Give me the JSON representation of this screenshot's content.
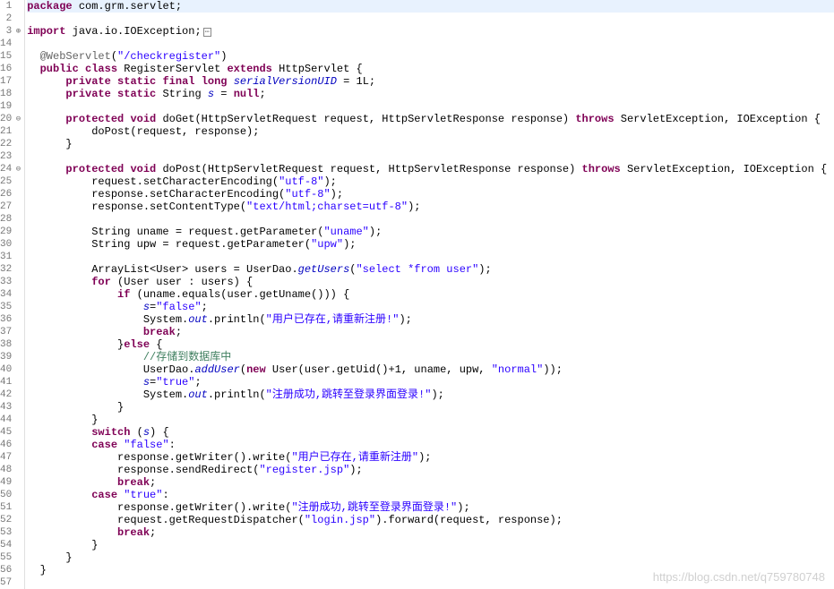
{
  "watermark": "https://blog.csdn.net/q759780748",
  "lines": [
    {
      "num": "1",
      "fold": "",
      "hl": true,
      "segs": [
        {
          "c": "kw",
          "t": "package"
        },
        {
          "t": " com.grm.servlet;"
        }
      ]
    },
    {
      "num": "2",
      "fold": "",
      "segs": []
    },
    {
      "num": "3",
      "fold": "⊕",
      "segs": [
        {
          "c": "kw",
          "t": "import"
        },
        {
          "t": " java.io.IOException;"
        },
        {
          "c": "expand",
          "t": " "
        }
      ]
    },
    {
      "num": "14",
      "fold": "",
      "segs": []
    },
    {
      "num": "15",
      "fold": "",
      "segs": [
        {
          "t": "  "
        },
        {
          "c": "ann",
          "t": "@WebServlet"
        },
        {
          "t": "("
        },
        {
          "c": "str",
          "t": "\"/checkregister\""
        },
        {
          "t": ")"
        }
      ]
    },
    {
      "num": "16",
      "fold": "",
      "segs": [
        {
          "t": "  "
        },
        {
          "c": "kw",
          "t": "public"
        },
        {
          "t": " "
        },
        {
          "c": "kw",
          "t": "class"
        },
        {
          "t": " RegisterServlet "
        },
        {
          "c": "kw",
          "t": "extends"
        },
        {
          "t": " HttpServlet {"
        }
      ]
    },
    {
      "num": "17",
      "fold": "",
      "segs": [
        {
          "t": "      "
        },
        {
          "c": "kw",
          "t": "private"
        },
        {
          "t": " "
        },
        {
          "c": "kw",
          "t": "static"
        },
        {
          "t": " "
        },
        {
          "c": "kw",
          "t": "final"
        },
        {
          "t": " "
        },
        {
          "c": "kw",
          "t": "long"
        },
        {
          "t": " "
        },
        {
          "c": "static-field",
          "t": "serialVersionUID"
        },
        {
          "t": " = 1L;"
        }
      ]
    },
    {
      "num": "18",
      "fold": "",
      "segs": [
        {
          "t": "      "
        },
        {
          "c": "kw",
          "t": "private"
        },
        {
          "t": " "
        },
        {
          "c": "kw",
          "t": "static"
        },
        {
          "t": " String "
        },
        {
          "c": "static-field",
          "t": "s"
        },
        {
          "t": " = "
        },
        {
          "c": "kw",
          "t": "null"
        },
        {
          "t": ";"
        }
      ]
    },
    {
      "num": "19",
      "fold": "",
      "segs": []
    },
    {
      "num": "20",
      "fold": "⊖",
      "segs": [
        {
          "t": "      "
        },
        {
          "c": "kw",
          "t": "protected"
        },
        {
          "t": " "
        },
        {
          "c": "kw",
          "t": "void"
        },
        {
          "t": " doGet(HttpServletRequest request, HttpServletResponse response) "
        },
        {
          "c": "kw",
          "t": "throws"
        },
        {
          "t": " ServletException, IOException {"
        }
      ]
    },
    {
      "num": "21",
      "fold": "",
      "segs": [
        {
          "t": "          doPost(request, response);"
        }
      ]
    },
    {
      "num": "22",
      "fold": "",
      "segs": [
        {
          "t": "      }"
        }
      ]
    },
    {
      "num": "23",
      "fold": "",
      "segs": []
    },
    {
      "num": "24",
      "fold": "⊖",
      "segs": [
        {
          "t": "      "
        },
        {
          "c": "kw",
          "t": "protected"
        },
        {
          "t": " "
        },
        {
          "c": "kw",
          "t": "void"
        },
        {
          "t": " doPost(HttpServletRequest request, HttpServletResponse response) "
        },
        {
          "c": "kw",
          "t": "throws"
        },
        {
          "t": " ServletException, IOException {"
        }
      ]
    },
    {
      "num": "25",
      "fold": "",
      "segs": [
        {
          "t": "          request.setCharacterEncoding("
        },
        {
          "c": "str",
          "t": "\"utf-8\""
        },
        {
          "t": ");"
        }
      ]
    },
    {
      "num": "26",
      "fold": "",
      "segs": [
        {
          "t": "          response.setCharacterEncoding("
        },
        {
          "c": "str",
          "t": "\"utf-8\""
        },
        {
          "t": ");"
        }
      ]
    },
    {
      "num": "27",
      "fold": "",
      "segs": [
        {
          "t": "          response.setContentType("
        },
        {
          "c": "str",
          "t": "\"text/html;charset=utf-8\""
        },
        {
          "t": ");"
        }
      ]
    },
    {
      "num": "28",
      "fold": "",
      "segs": []
    },
    {
      "num": "29",
      "fold": "",
      "segs": [
        {
          "t": "          String uname = request.getParameter("
        },
        {
          "c": "str",
          "t": "\"uname\""
        },
        {
          "t": ");"
        }
      ]
    },
    {
      "num": "30",
      "fold": "",
      "segs": [
        {
          "t": "          String upw = request.getParameter("
        },
        {
          "c": "str",
          "t": "\"upw\""
        },
        {
          "t": ");"
        }
      ]
    },
    {
      "num": "31",
      "fold": "",
      "segs": []
    },
    {
      "num": "32",
      "fold": "",
      "segs": [
        {
          "t": "          ArrayList<User> users = UserDao."
        },
        {
          "c": "static-field",
          "t": "getUsers"
        },
        {
          "t": "("
        },
        {
          "c": "str",
          "t": "\"select *from user\""
        },
        {
          "t": ");"
        }
      ]
    },
    {
      "num": "33",
      "fold": "",
      "segs": [
        {
          "t": "          "
        },
        {
          "c": "kw",
          "t": "for"
        },
        {
          "t": " (User user : users) {"
        }
      ]
    },
    {
      "num": "34",
      "fold": "",
      "segs": [
        {
          "t": "              "
        },
        {
          "c": "kw",
          "t": "if"
        },
        {
          "t": " (uname.equals(user.getUname())) {"
        }
      ]
    },
    {
      "num": "35",
      "fold": "",
      "segs": [
        {
          "t": "                  "
        },
        {
          "c": "static-field",
          "t": "s"
        },
        {
          "t": "="
        },
        {
          "c": "str",
          "t": "\"false\""
        },
        {
          "t": ";"
        }
      ]
    },
    {
      "num": "36",
      "fold": "",
      "segs": [
        {
          "t": "                  System."
        },
        {
          "c": "static-field",
          "t": "out"
        },
        {
          "t": ".println("
        },
        {
          "c": "str",
          "t": "\"用户已存在,请重新注册!\""
        },
        {
          "t": ");"
        }
      ]
    },
    {
      "num": "37",
      "fold": "",
      "segs": [
        {
          "t": "                  "
        },
        {
          "c": "kw",
          "t": "break"
        },
        {
          "t": ";"
        }
      ]
    },
    {
      "num": "38",
      "fold": "",
      "segs": [
        {
          "t": "              }"
        },
        {
          "c": "kw",
          "t": "else"
        },
        {
          "t": " {"
        }
      ]
    },
    {
      "num": "39",
      "fold": "",
      "segs": [
        {
          "t": "                  "
        },
        {
          "c": "cmt",
          "t": "//存储到数据库中"
        }
      ]
    },
    {
      "num": "40",
      "fold": "",
      "segs": [
        {
          "t": "                  UserDao."
        },
        {
          "c": "static-field",
          "t": "addUser"
        },
        {
          "t": "("
        },
        {
          "c": "kw",
          "t": "new"
        },
        {
          "t": " User(user.getUid()+1, uname, upw, "
        },
        {
          "c": "str",
          "t": "\"normal\""
        },
        {
          "t": "));"
        }
      ]
    },
    {
      "num": "41",
      "fold": "",
      "segs": [
        {
          "t": "                  "
        },
        {
          "c": "static-field",
          "t": "s"
        },
        {
          "t": "="
        },
        {
          "c": "str",
          "t": "\"true\""
        },
        {
          "t": ";"
        }
      ]
    },
    {
      "num": "42",
      "fold": "",
      "segs": [
        {
          "t": "                  System."
        },
        {
          "c": "static-field",
          "t": "out"
        },
        {
          "t": ".println("
        },
        {
          "c": "str",
          "t": "\"注册成功,跳转至登录界面登录!\""
        },
        {
          "t": ");"
        }
      ]
    },
    {
      "num": "43",
      "fold": "",
      "segs": [
        {
          "t": "              }"
        }
      ]
    },
    {
      "num": "44",
      "fold": "",
      "segs": [
        {
          "t": "          }"
        }
      ]
    },
    {
      "num": "45",
      "fold": "",
      "segs": [
        {
          "t": "          "
        },
        {
          "c": "kw",
          "t": "switch"
        },
        {
          "t": " ("
        },
        {
          "c": "static-field",
          "t": "s"
        },
        {
          "t": ") {"
        }
      ]
    },
    {
      "num": "46",
      "fold": "",
      "segs": [
        {
          "t": "          "
        },
        {
          "c": "kw",
          "t": "case"
        },
        {
          "t": " "
        },
        {
          "c": "str",
          "t": "\"false\""
        },
        {
          "t": ":"
        }
      ]
    },
    {
      "num": "47",
      "fold": "",
      "segs": [
        {
          "t": "              response.getWriter().write("
        },
        {
          "c": "str",
          "t": "\"用户已存在,请重新注册\""
        },
        {
          "t": ");"
        }
      ]
    },
    {
      "num": "48",
      "fold": "",
      "segs": [
        {
          "t": "              response.sendRedirect("
        },
        {
          "c": "str",
          "t": "\"register.jsp\""
        },
        {
          "t": ");"
        }
      ]
    },
    {
      "num": "49",
      "fold": "",
      "segs": [
        {
          "t": "              "
        },
        {
          "c": "kw",
          "t": "break"
        },
        {
          "t": ";"
        }
      ]
    },
    {
      "num": "50",
      "fold": "",
      "segs": [
        {
          "t": "          "
        },
        {
          "c": "kw",
          "t": "case"
        },
        {
          "t": " "
        },
        {
          "c": "str",
          "t": "\"true\""
        },
        {
          "t": ":"
        }
      ]
    },
    {
      "num": "51",
      "fold": "",
      "segs": [
        {
          "t": "              response.getWriter().write("
        },
        {
          "c": "str",
          "t": "\"注册成功,跳转至登录界面登录!\""
        },
        {
          "t": ");"
        }
      ]
    },
    {
      "num": "52",
      "fold": "",
      "segs": [
        {
          "t": "              request.getRequestDispatcher("
        },
        {
          "c": "str",
          "t": "\"login.jsp\""
        },
        {
          "t": ").forward(request, response);"
        }
      ]
    },
    {
      "num": "53",
      "fold": "",
      "segs": [
        {
          "t": "              "
        },
        {
          "c": "kw",
          "t": "break"
        },
        {
          "t": ";"
        }
      ]
    },
    {
      "num": "54",
      "fold": "",
      "segs": [
        {
          "t": "          }"
        }
      ]
    },
    {
      "num": "55",
      "fold": "",
      "segs": [
        {
          "t": "      }"
        }
      ]
    },
    {
      "num": "56",
      "fold": "",
      "segs": [
        {
          "t": "  }"
        }
      ]
    },
    {
      "num": "57",
      "fold": "",
      "segs": []
    }
  ]
}
